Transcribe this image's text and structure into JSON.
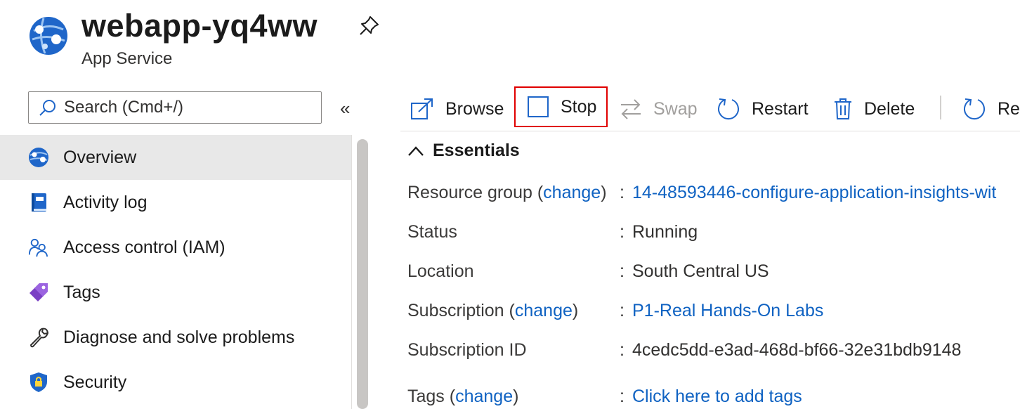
{
  "header": {
    "title": "webapp-yq4ww",
    "subtitle": "App Service"
  },
  "search": {
    "placeholder": "Search (Cmd+/)"
  },
  "sidebar": {
    "collapse_glyph": "«",
    "items": [
      {
        "label": "Overview",
        "icon": "app-service-globe-icon",
        "active": true
      },
      {
        "label": "Activity log",
        "icon": "activity-log-book-icon"
      },
      {
        "label": "Access control (IAM)",
        "icon": "people-icon"
      },
      {
        "label": "Tags",
        "icon": "tag-icon"
      },
      {
        "label": "Diagnose and solve problems",
        "icon": "wrench-icon"
      },
      {
        "label": "Security",
        "icon": "shield-lock-icon"
      }
    ]
  },
  "toolbar": {
    "browse": "Browse",
    "stop": "Stop",
    "swap": "Swap",
    "restart": "Restart",
    "delete": "Delete",
    "refresh": "Refresh"
  },
  "essentials": {
    "title": "Essentials",
    "change": "change",
    "rows": [
      {
        "label": "Resource group",
        "has_change": true,
        "value": "14-48593446-configure-application-insights-wit",
        "link": true
      },
      {
        "label": "Status",
        "value": "Running"
      },
      {
        "label": "Location",
        "value": "South Central US"
      },
      {
        "label": "Subscription",
        "has_change": true,
        "value": "P1-Real Hands-On Labs",
        "link": true
      },
      {
        "label": "Subscription ID",
        "value": "4cedc5dd-e3ad-468d-bf66-32e31bdb9148"
      },
      {
        "label": "Tags",
        "has_change": true,
        "value": "Click here to add tags",
        "link": true
      }
    ]
  },
  "colors": {
    "accent": "#0f62c2",
    "highlight_border": "#e00000",
    "active_nav_bg": "#e8e8e8"
  }
}
